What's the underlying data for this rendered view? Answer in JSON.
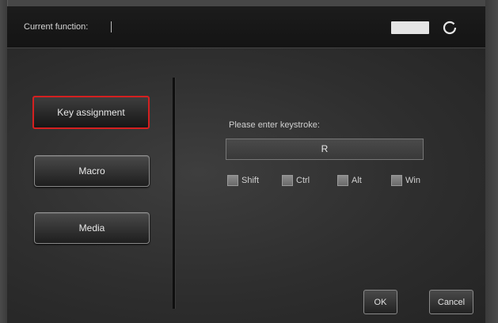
{
  "header": {
    "label": "Current function:",
    "value": ""
  },
  "sidebar": {
    "items": [
      {
        "label": "Key assignment",
        "selected": true
      },
      {
        "label": "Macro",
        "selected": false
      },
      {
        "label": "Media",
        "selected": false
      }
    ]
  },
  "main": {
    "prompt": "Please enter keystroke:",
    "keystroke_value": "R",
    "modifiers": [
      {
        "label": "Shift",
        "checked": false
      },
      {
        "label": "Ctrl",
        "checked": false
      },
      {
        "label": "Alt",
        "checked": false
      },
      {
        "label": "Win",
        "checked": false
      }
    ]
  },
  "buttons": {
    "ok": "OK",
    "cancel": "Cancel"
  },
  "colors": {
    "selected_outline": "#d42020",
    "background": "#2f2f2f"
  }
}
